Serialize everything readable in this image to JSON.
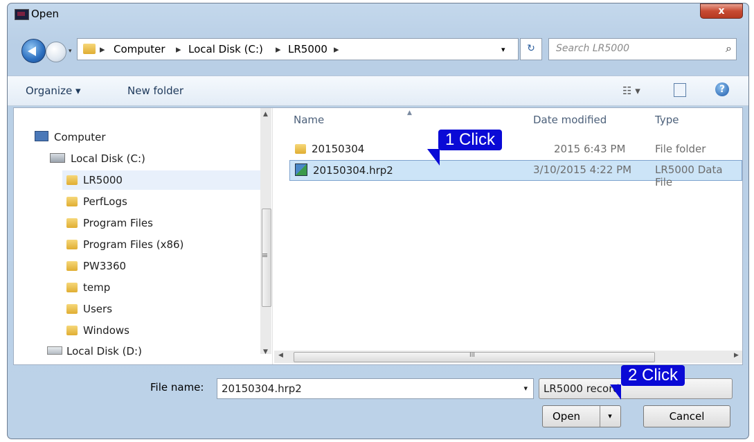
{
  "window": {
    "title": "Open",
    "close_glyph": "x",
    "app_icon": "app-icon"
  },
  "navigation": {
    "breadcrumbs": [
      "Computer",
      "Local Disk (C:)",
      "LR5000"
    ],
    "separator": "▸",
    "search_placeholder": "Search LR5000",
    "refresh_glyph": "↻",
    "dropdown_glyph": "▾"
  },
  "toolbar": {
    "organize": "Organize ▾",
    "new_folder": "New folder",
    "view_glyph": "☷ ▾",
    "help_glyph": "?"
  },
  "tree": {
    "computer": "Computer",
    "local_c": "Local Disk (C:)",
    "folders": [
      "LR5000",
      "PerfLogs",
      "Program Files",
      "Program Files (x86)",
      "PW3360",
      "temp",
      "Users",
      "Windows"
    ],
    "local_d": "Local Disk (D:)"
  },
  "columns": {
    "name": "Name",
    "date": "Date modified",
    "type": "Type"
  },
  "files": [
    {
      "name": "20150304",
      "date": "2015 6:43 PM",
      "type": "File folder"
    },
    {
      "name": "20150304.hrp2",
      "date": "3/10/2015 4:22 PM",
      "type": "LR5000 Data File"
    }
  ],
  "scroll": {
    "h_grip": "III",
    "v_grip": "≡"
  },
  "footer": {
    "file_name_label": "File name:",
    "file_name_value": "20150304.hrp2",
    "file_type_value": "LR5000 record",
    "open": "Open",
    "cancel": "Cancel"
  },
  "callouts": {
    "first": "1  Click",
    "second": "2  Click"
  },
  "colors": {
    "callout": "#0a0ad6",
    "selection": "#cce4f7",
    "frame": "#bcd2e8"
  }
}
